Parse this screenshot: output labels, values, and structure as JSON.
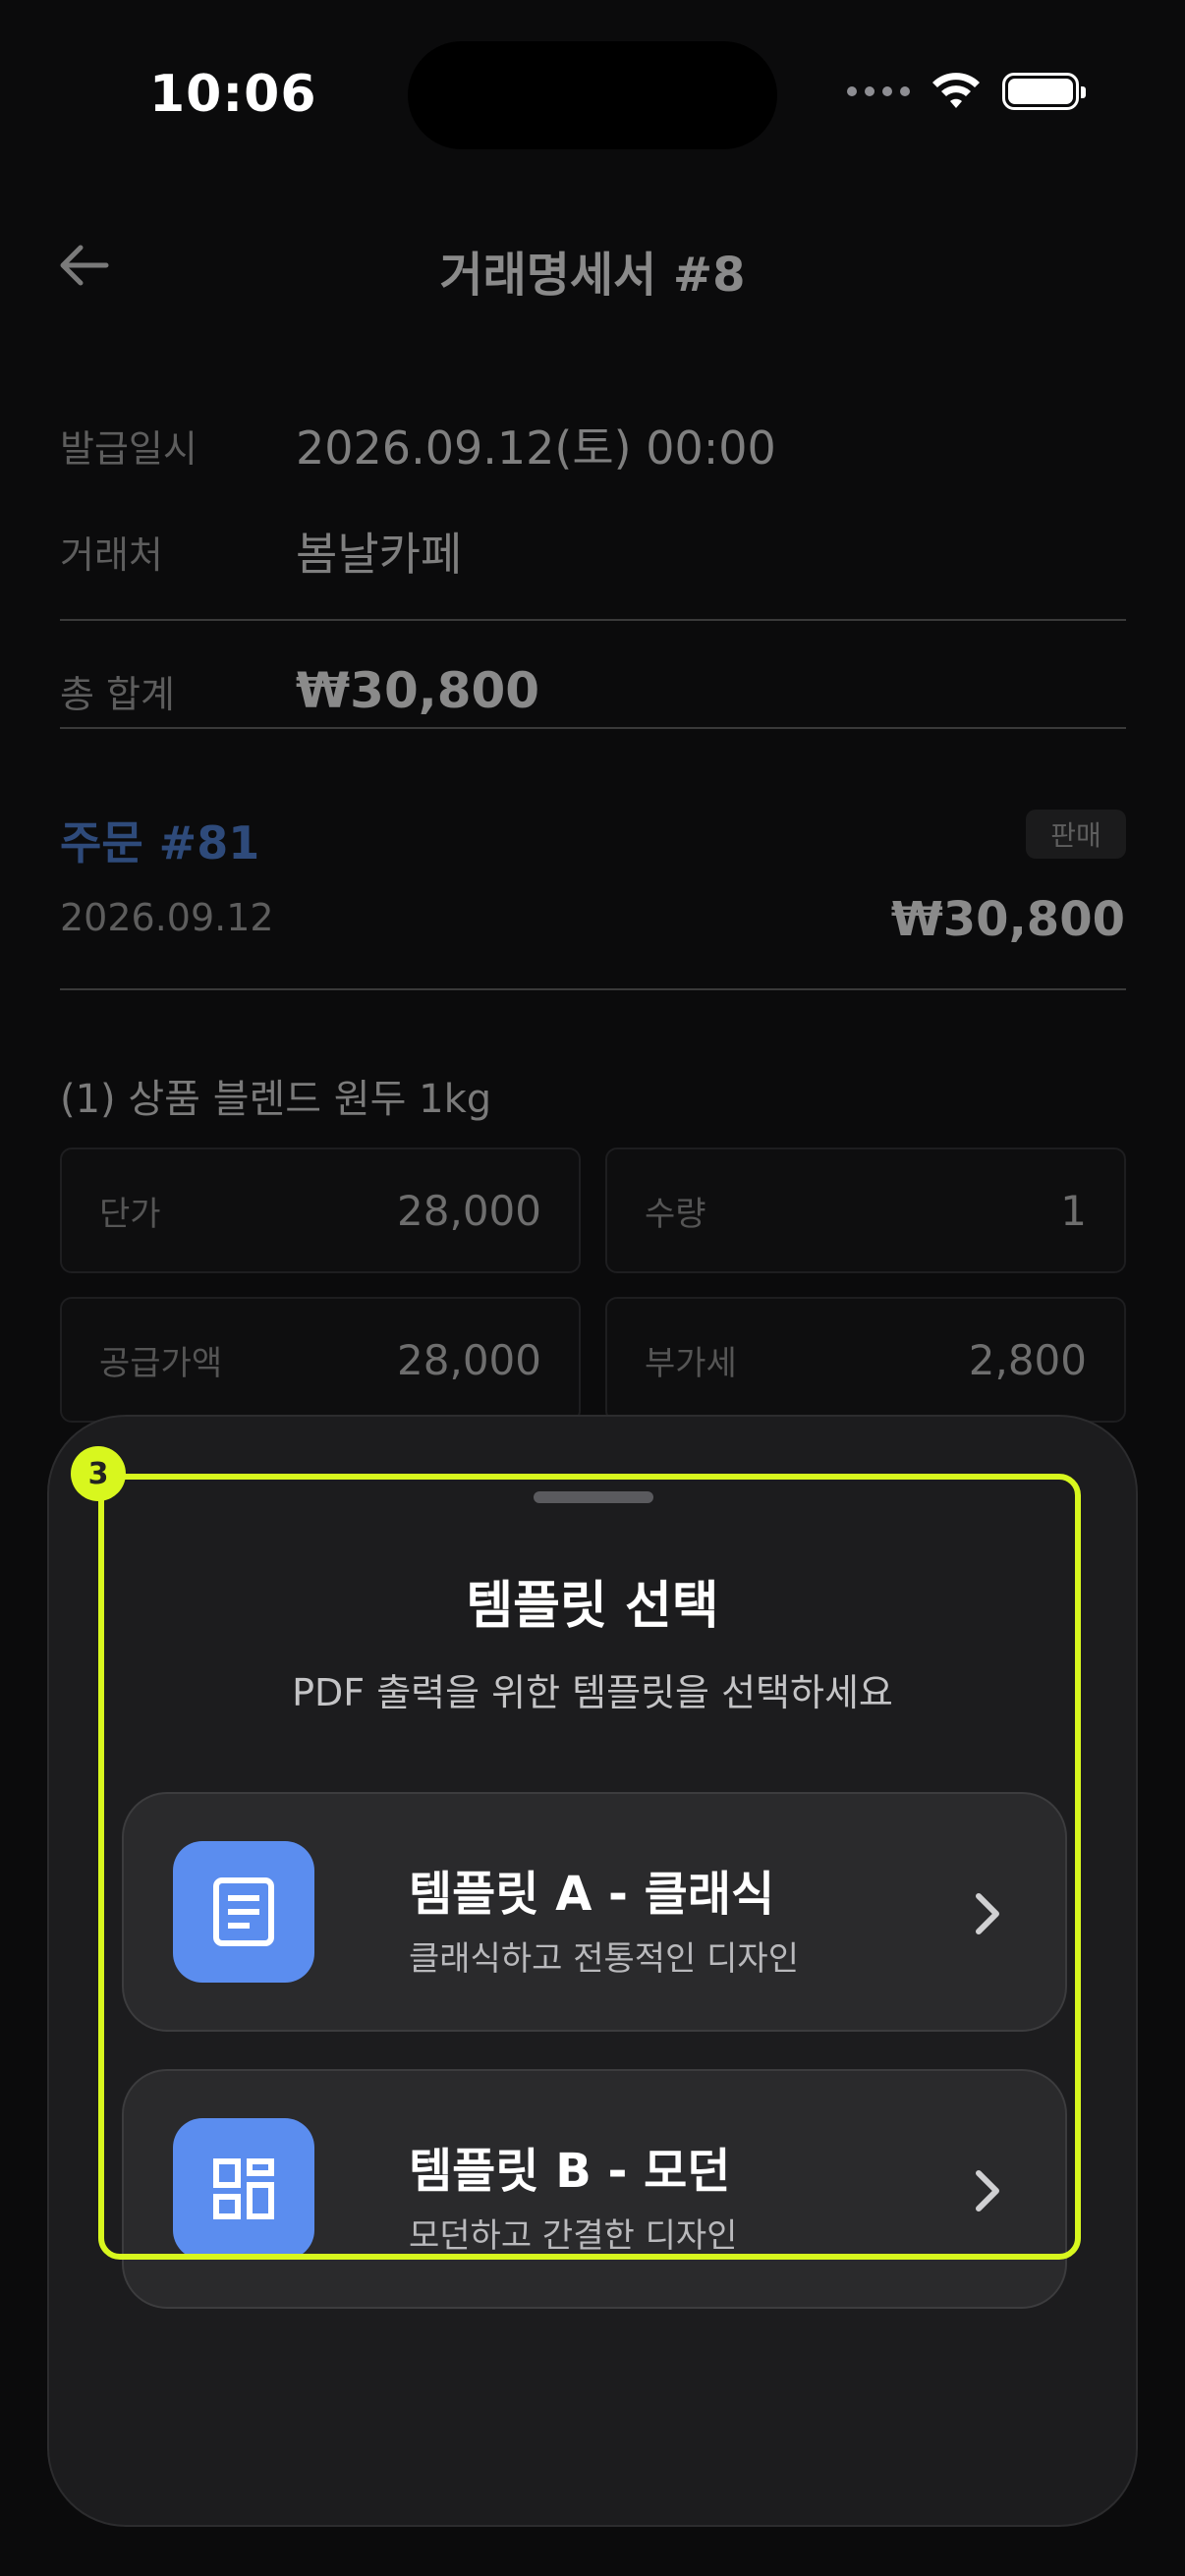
{
  "status_bar": {
    "time": "10:06"
  },
  "header": {
    "title": "거래명세서 #8"
  },
  "invoice": {
    "issued_label": "발급일시",
    "issued_value": "2026.09.12(토) 00:00",
    "partner_label": "거래처",
    "partner_value": "봄날카페",
    "total_label": "총 합계",
    "total_value": "₩30,800"
  },
  "order": {
    "title": "주문 #81",
    "badge": "판매",
    "date": "2026.09.12",
    "amount": "₩30,800"
  },
  "item": {
    "title": "(1) 상품   블렌드 원두 1kg",
    "cells": [
      {
        "label": "단가",
        "value": "28,000"
      },
      {
        "label": "수량",
        "value": "1"
      },
      {
        "label": "공급가액",
        "value": "28,000"
      },
      {
        "label": "부가세",
        "value": "2,800"
      }
    ]
  },
  "sheet": {
    "title": "템플릿 선택",
    "subtitle": "PDF 출력을 위한 템플릿을 선택하세요",
    "templates": [
      {
        "title": "템플릿 A - 클래식",
        "description": "클래식하고 전통적인 디자인",
        "icon": "document-icon"
      },
      {
        "title": "템플릿 B - 모던",
        "description": "모던하고 간결한 디자인",
        "icon": "layout-grid-icon"
      }
    ]
  },
  "highlight": {
    "badge": "3"
  },
  "colors": {
    "accent": "#5b8def",
    "highlight": "#d8f71e",
    "sheet_background": "#1c1c1e",
    "card_background": "#2a2a2c"
  }
}
